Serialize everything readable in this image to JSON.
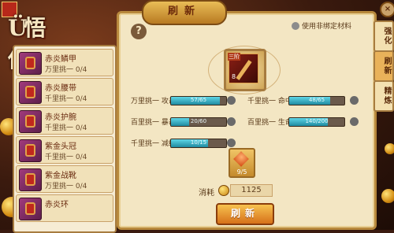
{
  "panel": {
    "title": "刷新"
  },
  "options": {
    "use_unbound_label": "使用非绑定材料"
  },
  "equipped": {
    "badge": "三阶",
    "level": "8"
  },
  "stats": [
    {
      "label": "万里挑一 攻击",
      "value": "57/65",
      "progress": 0.88
    },
    {
      "label": "千里挑一 命中",
      "value": "48/65",
      "progress": 0.74
    },
    {
      "label": "百里挑一 暴击",
      "value": "20/60",
      "progress": 0.33
    },
    {
      "label": "百里挑一 生命",
      "value": "140/200",
      "progress": 0.7
    },
    {
      "label": "千里挑一 减级",
      "value": "10/15",
      "progress": 0.67
    }
  ],
  "material": {
    "count": "9/5"
  },
  "cost": {
    "label": "消耗",
    "amount": "1125"
  },
  "refresh_button": "刷新",
  "tabs": [
    {
      "label": "强化",
      "active": false
    },
    {
      "label": "刷新",
      "active": true
    },
    {
      "label": "精炼",
      "active": false
    }
  ],
  "items": [
    {
      "name": "赤炎鳞甲",
      "sub": "万里挑一 0/4"
    },
    {
      "name": "赤炎腰带",
      "sub": "千里挑一 0/4"
    },
    {
      "name": "赤炎护腕",
      "sub": "千里挑一 0/4"
    },
    {
      "name": "紫金头冠",
      "sub": "千里挑一 0/4"
    },
    {
      "name": "紫金战靴",
      "sub": "万里挑一 0/4"
    },
    {
      "name": "赤炎环",
      "sub": ""
    }
  ],
  "logo": {
    "title": "Ü悟传"
  }
}
